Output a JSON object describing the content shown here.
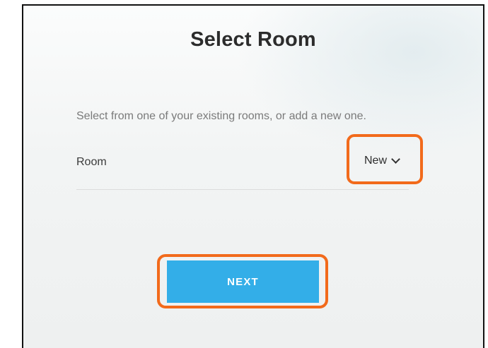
{
  "dialog": {
    "title": "Select Room",
    "subtitle": "Select from one of your existing rooms, or add a new one."
  },
  "room_field": {
    "label": "Room",
    "selected_value": "New",
    "icon": "chevron-down-icon"
  },
  "actions": {
    "next_label": "NEXT"
  },
  "colors": {
    "primary_button": "#33aee8",
    "highlight": "#f26a1b"
  }
}
